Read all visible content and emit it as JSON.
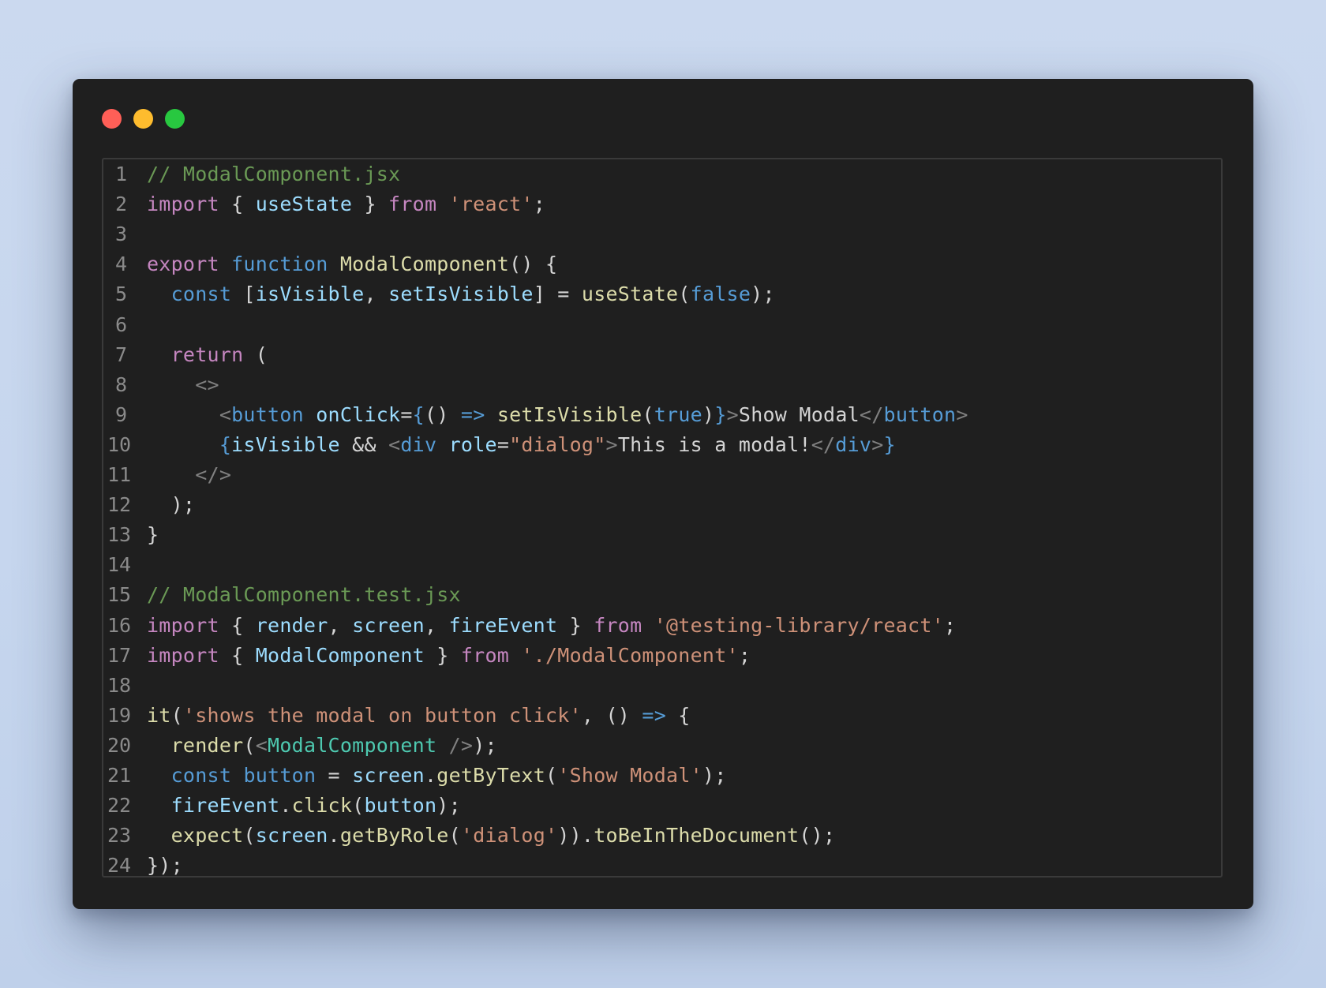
{
  "window": {
    "controls": [
      "close",
      "minimize",
      "maximize"
    ]
  },
  "colors": {
    "comment": "#6a9955",
    "keyword": "#c586c0",
    "storage": "#569cd6",
    "function": "#dcdcaa",
    "variable": "#9cdcfe",
    "string": "#ce9178",
    "punctuation": "#d4d4d4",
    "tag_punctuation": "#808080",
    "component": "#4ec9b0"
  },
  "code": {
    "lines": [
      {
        "n": "1",
        "tokens": [
          [
            "comment",
            "// ModalComponent.jsx"
          ]
        ]
      },
      {
        "n": "2",
        "tokens": [
          [
            "keyword",
            "import"
          ],
          [
            "punc",
            " { "
          ],
          [
            "var",
            "useState"
          ],
          [
            "punc",
            " } "
          ],
          [
            "keyword",
            "from"
          ],
          [
            "punc",
            " "
          ],
          [
            "str",
            "'react'"
          ],
          [
            "punc",
            ";"
          ]
        ]
      },
      {
        "n": "3",
        "tokens": []
      },
      {
        "n": "4",
        "tokens": [
          [
            "keyword",
            "export"
          ],
          [
            "punc",
            " "
          ],
          [
            "storage",
            "function"
          ],
          [
            "punc",
            " "
          ],
          [
            "func",
            "ModalComponent"
          ],
          [
            "punc",
            "() {"
          ]
        ]
      },
      {
        "n": "5",
        "tokens": [
          [
            "punc",
            "  "
          ],
          [
            "storage",
            "const"
          ],
          [
            "punc",
            " ["
          ],
          [
            "var",
            "isVisible"
          ],
          [
            "punc",
            ", "
          ],
          [
            "var",
            "setIsVisible"
          ],
          [
            "punc",
            "] = "
          ],
          [
            "func",
            "useState"
          ],
          [
            "punc",
            "("
          ],
          [
            "storage",
            "false"
          ],
          [
            "punc",
            ");"
          ]
        ]
      },
      {
        "n": "6",
        "tokens": []
      },
      {
        "n": "7",
        "tokens": [
          [
            "punc",
            "  "
          ],
          [
            "keyword",
            "return"
          ],
          [
            "punc",
            " ("
          ]
        ]
      },
      {
        "n": "8",
        "tokens": [
          [
            "punc",
            "    "
          ],
          [
            "tagp",
            "<>"
          ]
        ]
      },
      {
        "n": "9",
        "tokens": [
          [
            "punc",
            "      "
          ],
          [
            "tagp",
            "<"
          ],
          [
            "tag",
            "button"
          ],
          [
            "punc",
            " "
          ],
          [
            "attr",
            "onClick"
          ],
          [
            "punc",
            "="
          ],
          [
            "brace",
            "{"
          ],
          [
            "punc",
            "() "
          ],
          [
            "storage",
            "=>"
          ],
          [
            "punc",
            " "
          ],
          [
            "func",
            "setIsVisible"
          ],
          [
            "punc",
            "("
          ],
          [
            "storage",
            "true"
          ],
          [
            "punc",
            ")"
          ],
          [
            "brace",
            "}"
          ],
          [
            "tagp",
            ">"
          ],
          [
            "text",
            "Show Modal"
          ],
          [
            "tagp",
            "</"
          ],
          [
            "tag",
            "button"
          ],
          [
            "tagp",
            ">"
          ]
        ]
      },
      {
        "n": "10",
        "tokens": [
          [
            "punc",
            "      "
          ],
          [
            "brace",
            "{"
          ],
          [
            "var",
            "isVisible"
          ],
          [
            "punc",
            " && "
          ],
          [
            "tagp",
            "<"
          ],
          [
            "tag",
            "div"
          ],
          [
            "punc",
            " "
          ],
          [
            "attr",
            "role"
          ],
          [
            "punc",
            "="
          ],
          [
            "str",
            "\"dialog\""
          ],
          [
            "tagp",
            ">"
          ],
          [
            "text",
            "This is a modal!"
          ],
          [
            "tagp",
            "</"
          ],
          [
            "tag",
            "div"
          ],
          [
            "tagp",
            ">"
          ],
          [
            "brace",
            "}"
          ]
        ]
      },
      {
        "n": "11",
        "tokens": [
          [
            "punc",
            "    "
          ],
          [
            "tagp",
            "</>"
          ]
        ]
      },
      {
        "n": "12",
        "tokens": [
          [
            "punc",
            "  );"
          ]
        ]
      },
      {
        "n": "13",
        "tokens": [
          [
            "punc",
            "}"
          ]
        ]
      },
      {
        "n": "14",
        "tokens": []
      },
      {
        "n": "15",
        "tokens": [
          [
            "comment",
            "// ModalComponent.test.jsx"
          ]
        ]
      },
      {
        "n": "16",
        "tokens": [
          [
            "keyword",
            "import"
          ],
          [
            "punc",
            " { "
          ],
          [
            "var",
            "render"
          ],
          [
            "punc",
            ", "
          ],
          [
            "var",
            "screen"
          ],
          [
            "punc",
            ", "
          ],
          [
            "var",
            "fireEvent"
          ],
          [
            "punc",
            " } "
          ],
          [
            "keyword",
            "from"
          ],
          [
            "punc",
            " "
          ],
          [
            "str",
            "'@testing-library/react'"
          ],
          [
            "punc",
            ";"
          ]
        ]
      },
      {
        "n": "17",
        "tokens": [
          [
            "keyword",
            "import"
          ],
          [
            "punc",
            " { "
          ],
          [
            "var",
            "ModalComponent"
          ],
          [
            "punc",
            " } "
          ],
          [
            "keyword",
            "from"
          ],
          [
            "punc",
            " "
          ],
          [
            "str",
            "'./ModalComponent'"
          ],
          [
            "punc",
            ";"
          ]
        ]
      },
      {
        "n": "18",
        "tokens": []
      },
      {
        "n": "19",
        "tokens": [
          [
            "func",
            "it"
          ],
          [
            "punc",
            "("
          ],
          [
            "str",
            "'shows the modal on button click'"
          ],
          [
            "punc",
            ", () "
          ],
          [
            "storage",
            "=>"
          ],
          [
            "punc",
            " {"
          ]
        ]
      },
      {
        "n": "20",
        "tokens": [
          [
            "punc",
            "  "
          ],
          [
            "func",
            "render"
          ],
          [
            "punc",
            "("
          ],
          [
            "tagp",
            "<"
          ],
          [
            "comp",
            "ModalComponent"
          ],
          [
            "punc",
            " "
          ],
          [
            "tagp",
            "/>"
          ],
          [
            "punc",
            ");"
          ]
        ]
      },
      {
        "n": "21",
        "tokens": [
          [
            "punc",
            "  "
          ],
          [
            "storage",
            "const"
          ],
          [
            "punc",
            " "
          ],
          [
            "storage",
            "button"
          ],
          [
            "punc",
            " = "
          ],
          [
            "var",
            "screen"
          ],
          [
            "punc",
            "."
          ],
          [
            "func",
            "getByText"
          ],
          [
            "punc",
            "("
          ],
          [
            "str",
            "'Show Modal'"
          ],
          [
            "punc",
            ");"
          ]
        ]
      },
      {
        "n": "22",
        "tokens": [
          [
            "punc",
            "  "
          ],
          [
            "var",
            "fireEvent"
          ],
          [
            "punc",
            "."
          ],
          [
            "func",
            "click"
          ],
          [
            "punc",
            "("
          ],
          [
            "var",
            "button"
          ],
          [
            "punc",
            ");"
          ]
        ]
      },
      {
        "n": "23",
        "tokens": [
          [
            "punc",
            "  "
          ],
          [
            "func",
            "expect"
          ],
          [
            "punc",
            "("
          ],
          [
            "var",
            "screen"
          ],
          [
            "punc",
            "."
          ],
          [
            "func",
            "getByRole"
          ],
          [
            "punc",
            "("
          ],
          [
            "str",
            "'dialog'"
          ],
          [
            "punc",
            "))."
          ],
          [
            "func",
            "toBeInTheDocument"
          ],
          [
            "punc",
            "();"
          ]
        ]
      },
      {
        "n": "24",
        "tokens": [
          [
            "punc",
            "});"
          ]
        ]
      }
    ]
  }
}
